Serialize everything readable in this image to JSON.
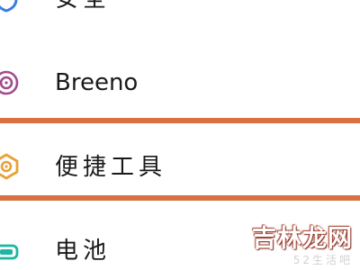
{
  "settings_list": {
    "items": [
      {
        "label": "安全",
        "icon": "security-icon"
      },
      {
        "label": "Breeno",
        "icon": "breeno-icon"
      },
      {
        "label": "便捷工具",
        "icon": "convenience-tools-icon"
      },
      {
        "label": "电池",
        "icon": "battery-icon"
      }
    ],
    "highlighted_index": 2
  },
  "colors": {
    "highlight": "#d8703f",
    "breeno_icon": "#a14b8c",
    "tools_icon": "#e8a236",
    "battery_icon": "#1fb5a3"
  },
  "watermark": {
    "brand": "吉林龙网",
    "sub": "52生活吧"
  }
}
